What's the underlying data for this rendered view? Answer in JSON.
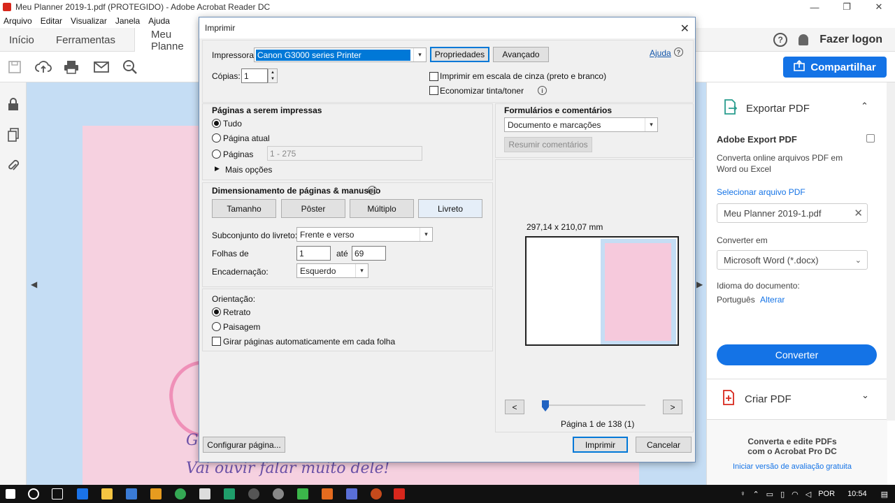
{
  "window": {
    "title": "Meu Planner 2019-1.pdf (PROTEGIDO) - Adobe Acrobat Reader DC"
  },
  "menu": [
    "Arquivo",
    "Editar",
    "Visualizar",
    "Janela",
    "Ajuda"
  ],
  "tabs": {
    "home": "Início",
    "tools": "Ferramentas",
    "doc": "Meu Planne"
  },
  "header": {
    "login": "Fazer logon",
    "share": "Compartilhar"
  },
  "document": {
    "script_text": "Vai ouvir falar muito dele!",
    "script_partial": "G"
  },
  "right_panel": {
    "export_title": "Exportar PDF",
    "adobe_export": "Adobe Export PDF",
    "desc_line1": "Converta online arquivos PDF em",
    "desc_line2": "Word ou Excel",
    "select_file": "Selecionar arquivo PDF",
    "file_name": "Meu Planner 2019-1.pdf",
    "convert_to_label": "Converter em",
    "convert_format": "Microsoft Word (*.docx)",
    "doc_language_label": "Idioma do documento:",
    "doc_language": "Português",
    "change": "Alterar",
    "convert_button": "Converter",
    "create_pdf": "Criar PDF",
    "promo_line1": "Converta e edite PDFs",
    "promo_line2": "com o Acrobat Pro DC",
    "trial_link": "Iniciar versão de avaliação gratuita"
  },
  "taskbar": {
    "language": "POR",
    "time": "10:54"
  },
  "dialog": {
    "title": "Imprimir",
    "printer_label": "Impressora:",
    "printer_value": "Canon G3000 series Printer",
    "properties": "Propriedades",
    "advanced": "Avançado",
    "help": "Ajuda",
    "copies_label": "Cópias:",
    "copies_value": "1",
    "grayscale": "Imprimir em escala de cinza (preto e branco)",
    "save_ink": "Economizar tinta/toner",
    "pages_section": "Páginas a serem impressas",
    "pages_all": "Tudo",
    "pages_current": "Página atual",
    "pages_range": "Páginas",
    "pages_range_value": "1 - 275",
    "more_options": "Mais opções",
    "forms_section": "Formulários e comentários",
    "forms_value": "Documento e marcações",
    "summarize_comments": "Resumir comentários",
    "sizing_section": "Dimensionamento de páginas & manuseio",
    "size_btn": "Tamanho",
    "poster_btn": "Pôster",
    "multiple_btn": "Múltiplo",
    "booklet_btn": "Livreto",
    "booklet_subset_label": "Subconjunto do livreto:",
    "booklet_subset_value": "Frente e verso",
    "sheets_from_label": "Folhas de",
    "sheets_from_value": "1",
    "sheets_to_label": "até",
    "sheets_to_value": "69",
    "binding_label": "Encadernação:",
    "binding_value": "Esquerdo",
    "orientation_label": "Orientação:",
    "portrait": "Retrato",
    "landscape": "Paisagem",
    "auto_rotate": "Girar páginas automaticamente em cada folha",
    "preview_size": "297,14 x 210,07 mm",
    "prev_btn": "<",
    "next_btn": ">",
    "page_indicator": "Página 1 de 138 (1)",
    "page_setup": "Configurar página...",
    "print_btn": "Imprimir",
    "cancel_btn": "Cancelar"
  },
  "colors": {
    "accent": "#1473e6",
    "doc_background": "#c5ddf4",
    "page_pink": "#f6d1e0",
    "selection": "#0078d7"
  }
}
